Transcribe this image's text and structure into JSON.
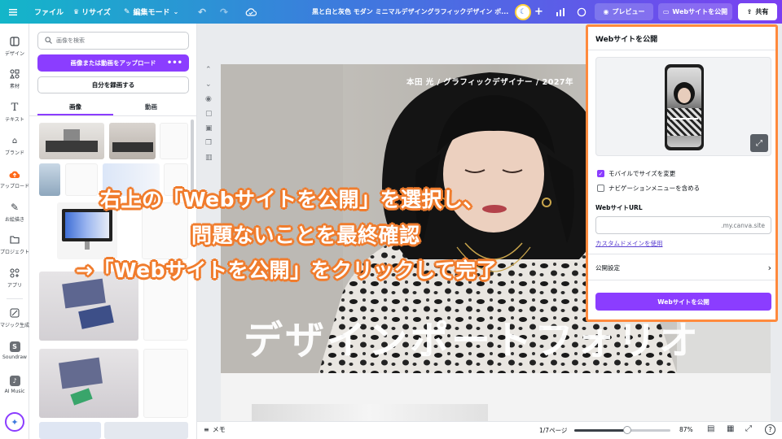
{
  "topbar": {
    "file_label": "ファイル",
    "resize_label": "リサイズ",
    "edit_mode_label": "編集モード",
    "doc_title": "黒と白と灰色 モダン ミニマルデザイングラフィックデザイン ポ...",
    "preview_label": "プレビュー",
    "publish_label": "Webサイトを公開",
    "share_label": "共有"
  },
  "rail": {
    "items": [
      {
        "label": "デザイン",
        "icon": "layout-icon"
      },
      {
        "label": "素材",
        "icon": "elements-icon"
      },
      {
        "label": "テキスト",
        "icon": "text-icon"
      },
      {
        "label": "ブランド",
        "icon": "brand-icon"
      },
      {
        "label": "アップロード",
        "icon": "upload-icon"
      },
      {
        "label": "お絵描き",
        "icon": "draw-icon"
      },
      {
        "label": "プロジェクト",
        "icon": "folder-icon"
      },
      {
        "label": "アプリ",
        "icon": "apps-icon"
      },
      {
        "label": "マジック生成",
        "icon": "magic-icon"
      },
      {
        "label": "Soundraw",
        "icon": "soundraw-icon"
      },
      {
        "label": "AI Music",
        "icon": "ai-music-icon"
      }
    ]
  },
  "panel": {
    "search_placeholder": "画像を検索",
    "upload_button": "画像または動画をアップロード",
    "record_button": "自分を録画する",
    "tab_images": "画像",
    "tab_videos": "動画"
  },
  "design": {
    "header_text": "本田 光 / グラフィックデザイナー / 2027年",
    "title_text": "デザインポートフォリオ"
  },
  "bottombar": {
    "notes_label": "メモ",
    "page_indicator": "1/7ページ",
    "zoom": "87%",
    "zoom_fraction": 0.55
  },
  "popover": {
    "title": "Webサイトを公開",
    "resize_mobile_label": "モバイルでサイズを変更",
    "resize_mobile_checked": true,
    "nav_menu_label": "ナビゲーションメニューを含める",
    "nav_menu_checked": false,
    "url_label": "WebサイトURL",
    "url_suffix": ".my.canva.site",
    "custom_domain_link": "カスタムドメインを使用",
    "publish_settings": "公開設定",
    "publish_button": "Webサイトを公開"
  },
  "annotation": {
    "line1": "右上の「Webサイトを公開」を選択し、",
    "line2": "問題ないことを最終確認",
    "line3": "→「Webサイトを公開」をクリックして完了"
  },
  "colors": {
    "accent": "#8b3dff",
    "annotation_outline": "#f07c2d",
    "popover_border": "#ff8a3d"
  }
}
